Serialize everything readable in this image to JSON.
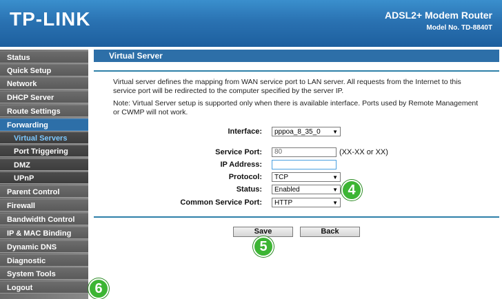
{
  "header": {
    "logo": "TP-LINK",
    "product_title": "ADSL2+ Modem Router",
    "model": "Model No. TD-8840T"
  },
  "sidebar": {
    "items": [
      {
        "label": "Status"
      },
      {
        "label": "Quick Setup"
      },
      {
        "label": "Network"
      },
      {
        "label": "DHCP Server"
      },
      {
        "label": "Route Settings"
      },
      {
        "label": "Forwarding"
      },
      {
        "label": "Virtual Servers"
      },
      {
        "label": "Port Triggering"
      },
      {
        "label": "DMZ"
      },
      {
        "label": "UPnP"
      },
      {
        "label": "Parent Control"
      },
      {
        "label": "Firewall"
      },
      {
        "label": "Bandwidth Control"
      },
      {
        "label": "IP & MAC Binding"
      },
      {
        "label": "Dynamic DNS"
      },
      {
        "label": "Diagnostic"
      },
      {
        "label": "System Tools"
      },
      {
        "label": "Logout"
      }
    ]
  },
  "page": {
    "title": "Virtual Server",
    "description": "Virtual server defines the mapping from WAN service port to LAN server. All requests from the Internet to this service port will be redirected to the computer specified by the server IP.",
    "note": "Note: Virtual Server setup is supported only when there is available interface. Ports used by Remote Management or CWMP will not work."
  },
  "form": {
    "interface_label": "Interface:",
    "interface_value": "pppoa_8_35_0",
    "service_port_label": "Service Port:",
    "service_port_value": "80",
    "service_port_hint": "(XX-XX or XX)",
    "ip_label": "IP Address:",
    "ip_value": "",
    "protocol_label": "Protocol:",
    "protocol_value": "TCP",
    "status_label": "Status:",
    "status_value": "Enabled",
    "common_port_label": "Common Service Port:",
    "common_port_value": "HTTP"
  },
  "buttons": {
    "save": "Save",
    "back": "Back"
  },
  "callouts": {
    "four": "4",
    "five": "5",
    "six": "6"
  },
  "colors": {
    "header_blue": "#2a72b2",
    "accent_blue": "#2d6fa8",
    "callout_green": "#3cb534"
  }
}
